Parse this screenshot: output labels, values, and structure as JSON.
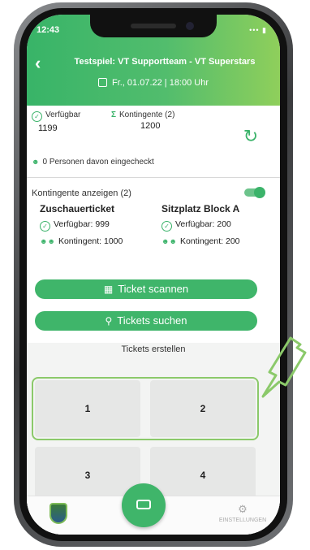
{
  "status": {
    "time": "12:43",
    "indicators": "••• ▮"
  },
  "header": {
    "back_label": "‹",
    "title": "Testspiel: VT Supportteam - VT Superstars",
    "date": "Fr., 01.07.22 | 18:00 Uhr"
  },
  "stats": {
    "available_label": "Verfügbar",
    "available_value": "1199",
    "contingents_label": "Kontingente (2)",
    "contingents_value": "1200",
    "checked_in": "0 Personen davon eingecheckt"
  },
  "contingents": {
    "toggle_label": "Kontingente anzeigen (2)",
    "toggle_on": true,
    "items": [
      {
        "name": "Zuschauerticket",
        "available": "Verfügbar: 999",
        "quota": "Kontingent: 1000"
      },
      {
        "name": "Sitzplatz Block A",
        "available": "Verfügbar: 200",
        "quota": "Kontingent: 200"
      }
    ]
  },
  "actions": {
    "scan_label": "Ticket scannen",
    "search_label": "Tickets suchen"
  },
  "tickets": {
    "title": "Tickets erstellen",
    "tiles": [
      "1",
      "2",
      "3",
      "4"
    ]
  },
  "tabbar": {
    "settings_label": "EINSTELLUNGEN"
  },
  "colors": {
    "accent": "#3fb56a",
    "header_start": "#38b468",
    "header_end": "#8fcf5b",
    "highlight": "#8bc96a"
  }
}
